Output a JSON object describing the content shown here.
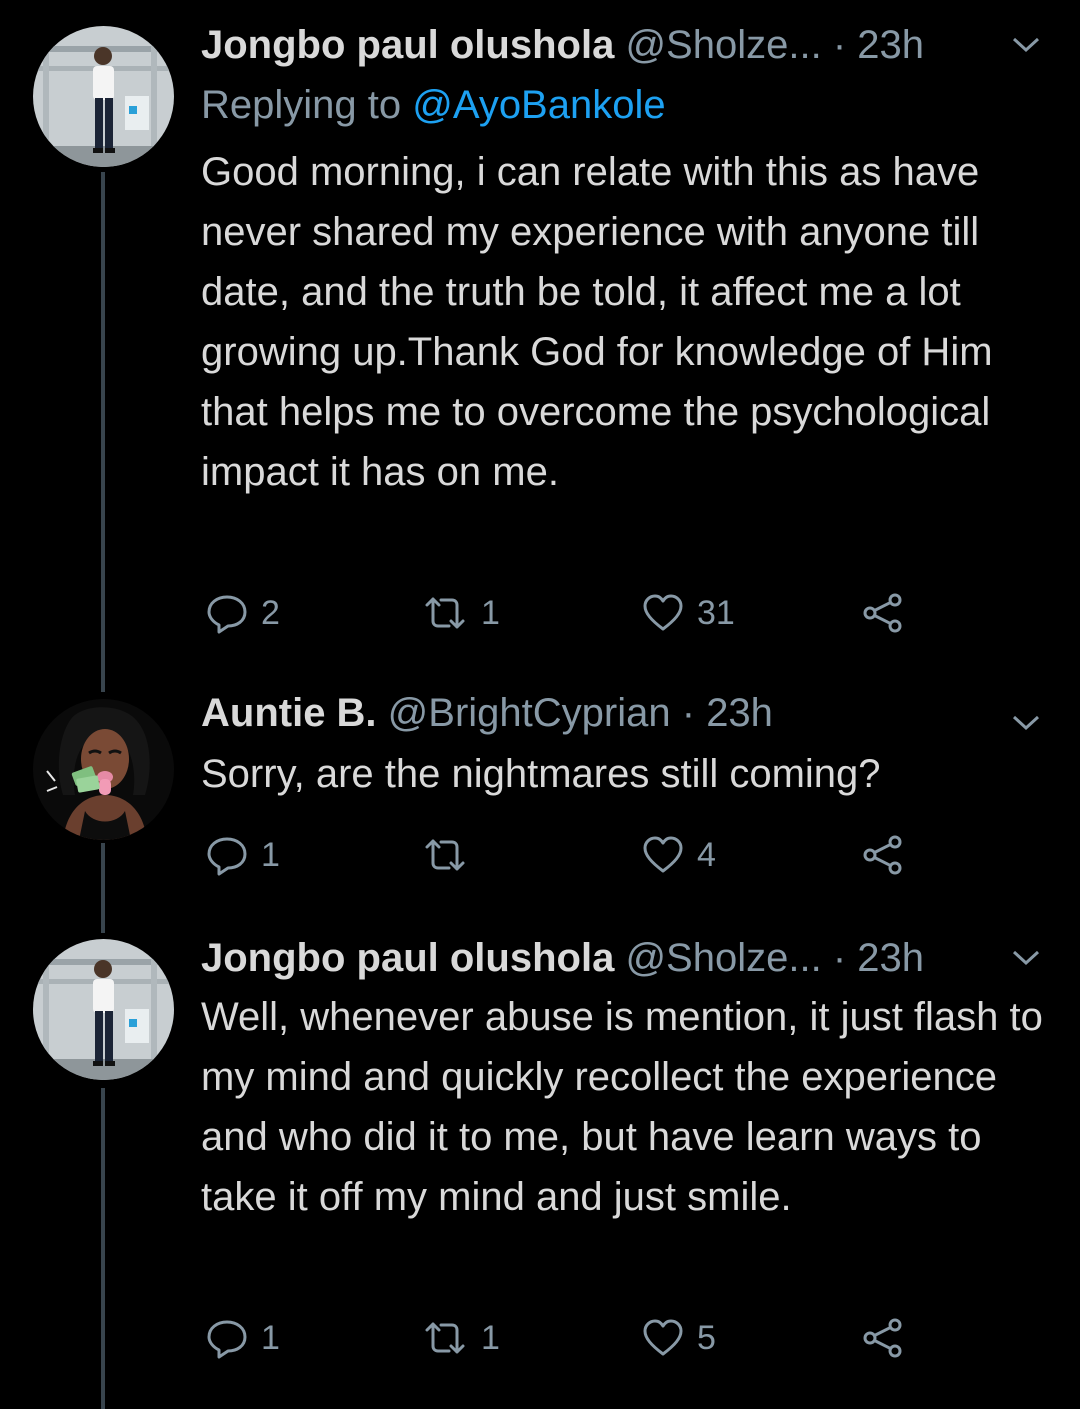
{
  "colors": {
    "background": "#000000",
    "text": "#d9d9d9",
    "secondary": "#8899a6",
    "accent": "#1da1f2",
    "thread_line": "#38444d"
  },
  "tweets": [
    {
      "name": "Jongbo paul olushola",
      "handle": "@Sholze...",
      "separator": "·",
      "time": "23h",
      "replying_prefix": "Replying to",
      "replying_to": "@AyoBankole",
      "text": "Good morning, i can relate with this as have never shared my experience with anyone till date, and the truth be told, it affect me a lot growing up.Thank God for knowledge of Him that helps me to overcome the psychological impact it has on me.",
      "replies": "2",
      "retweets": "1",
      "likes": "31",
      "avatar_icon": "profile-photo-man-standing"
    },
    {
      "name": "Auntie B.",
      "handle": "@BrightCyprian",
      "separator": "·",
      "time": "23h",
      "text": "Sorry, are the nightmares still coming?",
      "replies": "1",
      "retweets": "",
      "likes": "4",
      "avatar_icon": "profile-illustration-woman"
    },
    {
      "name": "Jongbo paul olushola",
      "handle": "@Sholze...",
      "separator": "·",
      "time": "23h",
      "text": "Well, whenever abuse is mention, it just flash to my mind and quickly recollect the experience and who did it to me, but have learn ways to take it off my mind and just smile.",
      "replies": "1",
      "retweets": "1",
      "likes": "5",
      "avatar_icon": "profile-photo-man-standing"
    }
  ]
}
